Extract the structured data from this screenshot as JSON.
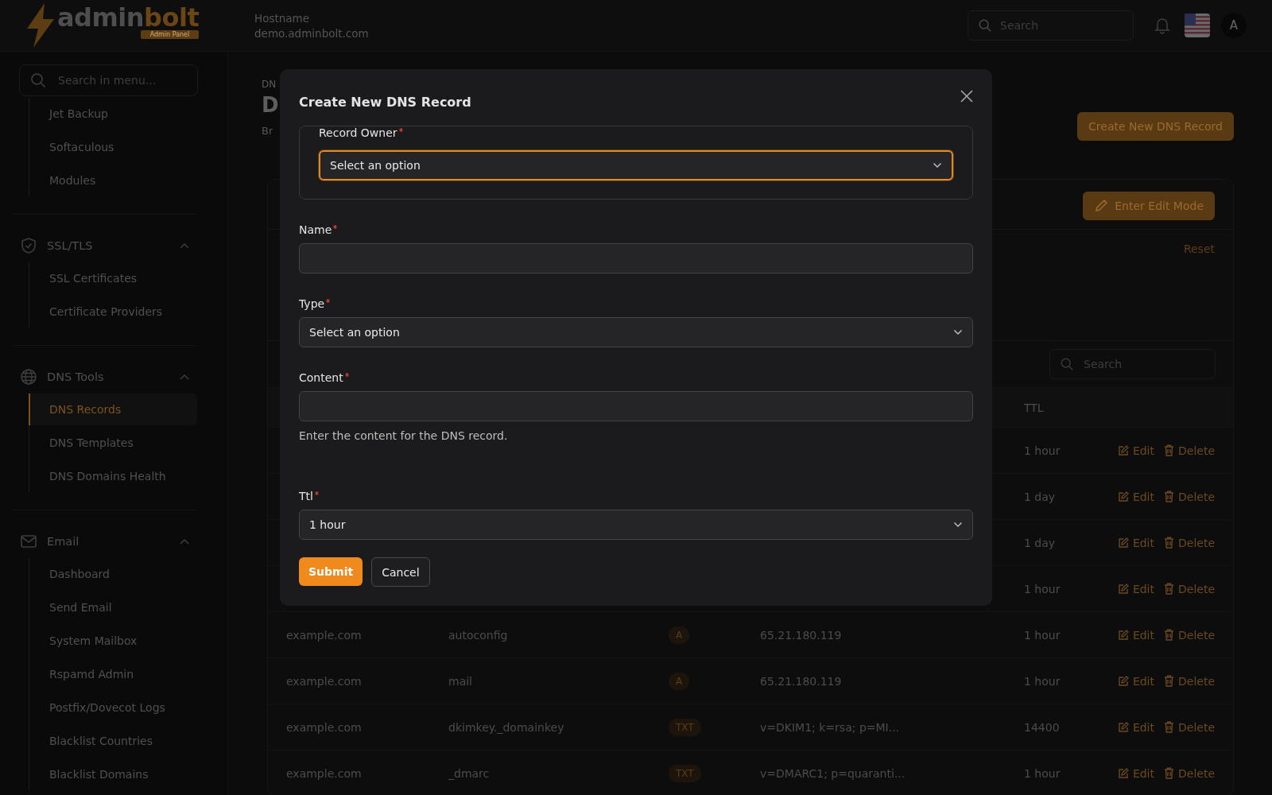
{
  "header": {
    "logo": {
      "word_a": "admin",
      "word_b": "bolt",
      "tag": "Admin Panel"
    },
    "host_label": "Hostname",
    "host_value": "demo.adminbolt.com",
    "search": {
      "placeholder": "Search"
    },
    "avatar": "A"
  },
  "sidebar": {
    "search": {
      "placeholder": "Search in menu..."
    },
    "groups": [
      {
        "items": [
          {
            "label": "Jet Backup",
            "selected": false
          },
          {
            "label": "Softaculous",
            "selected": false
          },
          {
            "label": "Modules",
            "selected": false
          }
        ]
      },
      {
        "kind": "security",
        "title": "SSL/TLS",
        "expanded": true,
        "items": [
          {
            "label": "SSL Certificates",
            "selected": false
          },
          {
            "label": "Certificate Providers",
            "selected": false
          }
        ]
      },
      {
        "kind": "network",
        "title": "DNS Tools",
        "expanded": true,
        "items": [
          {
            "label": "DNS Records",
            "selected": true
          },
          {
            "label": "DNS Templates",
            "selected": false
          },
          {
            "label": "DNS Domains Health",
            "selected": false
          }
        ]
      },
      {
        "kind": "email",
        "title": "Email",
        "expanded": true,
        "items": [
          {
            "label": "Dashboard",
            "selected": false
          },
          {
            "label": "Send Email",
            "selected": false
          },
          {
            "label": "System Mailbox",
            "selected": false
          },
          {
            "label": "Rspamd Admin",
            "selected": false
          },
          {
            "label": "Postfix/Dovecot Logs",
            "selected": false
          },
          {
            "label": "Blacklist Countries",
            "selected": false
          },
          {
            "label": "Blacklist Domains",
            "selected": false
          }
        ]
      }
    ]
  },
  "page": {
    "breadcrumb": "DN",
    "title": "D",
    "subtitle": "Br",
    "create_button": "Create New DNS Record",
    "edit_mode_button": "Enter Edit Mode",
    "reset": "Reset",
    "search": {
      "placeholder": "Search"
    },
    "table": {
      "ttl_heading": "TTL",
      "rows": [
        {
          "ttl": "1 hour",
          "edit": "Edit",
          "delete": "Delete"
        },
        {
          "ttl": "1 day",
          "edit": "Edit",
          "delete": "Delete"
        },
        {
          "ttl": "1 day",
          "edit": "Edit",
          "delete": "Delete"
        },
        {
          "ttl": "1 hour",
          "edit": "Edit",
          "delete": "Delete"
        },
        {
          "domain": "example.com",
          "name": "autoconfig",
          "type": "A",
          "content": "65.21.180.119",
          "ttl": "1 hour",
          "edit": "Edit",
          "delete": "Delete"
        },
        {
          "domain": "example.com",
          "name": "mail",
          "type": "A",
          "content": "65.21.180.119",
          "ttl": "1 hour",
          "edit": "Edit",
          "delete": "Delete"
        },
        {
          "domain": "example.com",
          "name": "dkimkey._domainkey",
          "type": "TXT",
          "content": "v=DKIM1; k=rsa; p=MI...",
          "ttl": "14400",
          "edit": "Edit",
          "delete": "Delete"
        },
        {
          "domain": "example.com",
          "name": "_dmarc",
          "type": "TXT",
          "content": "v=DMARC1; p=quaranti...",
          "ttl": "1 hour",
          "edit": "Edit",
          "delete": "Delete"
        }
      ]
    }
  },
  "modal": {
    "title": "Create New DNS Record",
    "fields": [
      {
        "kind": "fieldset",
        "label": "Record Owner",
        "required": true,
        "value": "Select an option",
        "focused": true
      },
      {
        "kind": "input",
        "label": "Name",
        "required": true
      },
      {
        "kind": "select",
        "label": "Type",
        "required": true,
        "value": "Select an option",
        "focused": false
      },
      {
        "kind": "input",
        "label": "Content",
        "required": true,
        "help": "Enter the content for the DNS record."
      },
      {
        "kind": "select",
        "label": "Ttl",
        "required": true,
        "value": "1 hour",
        "focused": false
      }
    ],
    "submit": "Submit",
    "cancel": "Cancel"
  }
}
